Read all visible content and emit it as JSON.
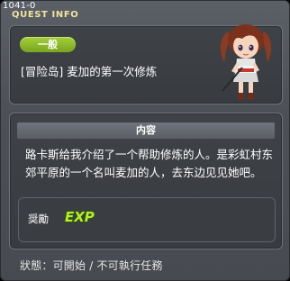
{
  "window": {
    "quest_id": "1041-0",
    "title": "QUEST INFO"
  },
  "quest": {
    "category": "一般",
    "name": "[冒险岛] 麦加的第一次修炼"
  },
  "content": {
    "header": "内容",
    "description": "路卡斯给我介绍了一个帮助修炼的人。是彩虹村东郊平原的一个名叫麦加的人，去东边见见她吧。"
  },
  "reward": {
    "label": "奨勵",
    "exp_text": "EXP",
    "exp_icon": "exp-icon"
  },
  "status": "狀態：可開始 / 不可執行任務",
  "colors": {
    "accent_green": "#8cc230",
    "title_gold": "#f3e2a0",
    "panel_bg": "#3c3f44"
  }
}
